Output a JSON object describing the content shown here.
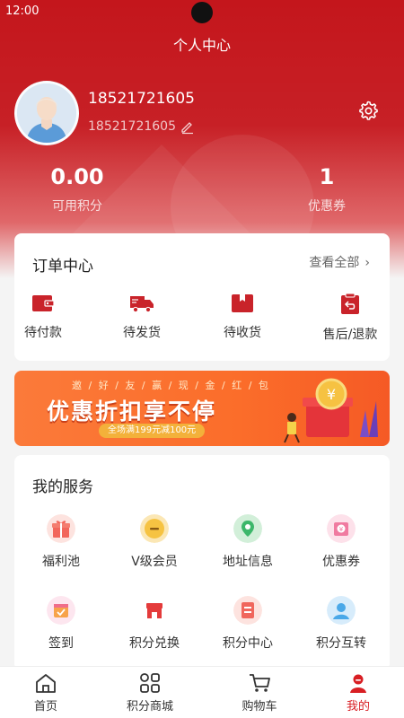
{
  "status": {
    "time": "12:00"
  },
  "nav": {
    "title": "个人中心"
  },
  "profile": {
    "name": "18521721605",
    "phone": "18521721605"
  },
  "stats": [
    {
      "value": "0.00",
      "label": "可用积分"
    },
    {
      "value": "1",
      "label": "优惠券"
    }
  ],
  "orders": {
    "title": "订单中心",
    "view_all": "查看全部",
    "items": [
      {
        "label": "待付款",
        "icon": "wallet-icon"
      },
      {
        "label": "待发货",
        "icon": "truck-icon"
      },
      {
        "label": "待收货",
        "icon": "box-icon"
      },
      {
        "label": "售后/退款",
        "icon": "return-icon"
      }
    ]
  },
  "banner": {
    "top_text": "邀 / 好 / 友 / 赢 / 现 / 金 / 红 / 包",
    "headline": "优惠折扣享不停",
    "promo": "全场满199元减100元"
  },
  "services": {
    "title": "我的服务",
    "items": [
      {
        "label": "福利池",
        "icon": "gift-icon"
      },
      {
        "label": "V级会员",
        "icon": "vip-badge-icon"
      },
      {
        "label": "地址信息",
        "icon": "location-pin-icon"
      },
      {
        "label": "优惠券",
        "icon": "coupon-icon"
      },
      {
        "label": "签到",
        "icon": "calendar-check-icon"
      },
      {
        "label": "积分兑换",
        "icon": "shop-icon"
      },
      {
        "label": "积分中心",
        "icon": "document-icon"
      },
      {
        "label": "积分互转",
        "icon": "transfer-avatar-icon"
      }
    ]
  },
  "tabbar": {
    "items": [
      {
        "label": "首页",
        "icon": "home-icon"
      },
      {
        "label": "积分商城",
        "icon": "grid-icon"
      },
      {
        "label": "购物车",
        "icon": "cart-icon"
      },
      {
        "label": "我的",
        "icon": "user-icon",
        "active": true
      }
    ]
  },
  "colors": {
    "primary": "#c72026",
    "active_tab": "#d81e23",
    "banner": "#fb6d2a",
    "background": "#f4f4f4"
  }
}
